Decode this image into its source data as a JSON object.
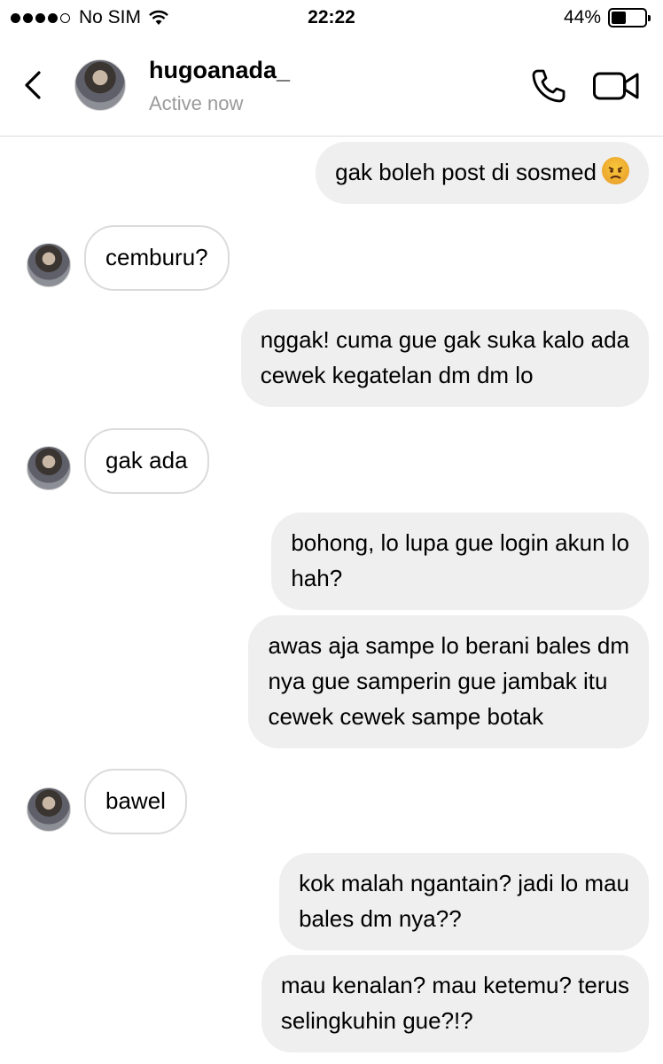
{
  "status_bar": {
    "carrier": "No SIM",
    "time": "22:22",
    "battery_percent": "44%",
    "battery_level": 0.44,
    "signal_bars": 4
  },
  "header": {
    "username": "hugoanada_",
    "status": "Active now",
    "back_icon": "chevron-left-icon",
    "call_icon": "phone-icon",
    "video_icon": "video-camera-icon"
  },
  "messages": [
    {
      "direction": "outgoing",
      "text": "gak boleh post di sosmed",
      "emoji": "angry-face"
    },
    {
      "direction": "incoming",
      "text": "cemburu?"
    },
    {
      "direction": "outgoing",
      "text": "nggak! cuma gue gak suka kalo ada\ncewek kegatelan dm dm lo"
    },
    {
      "direction": "incoming",
      "text": "gak ada"
    },
    {
      "direction": "outgoing",
      "text": "bohong, lo lupa gue login akun lo\nhah?"
    },
    {
      "direction": "outgoing",
      "text": "awas aja sampe lo berani bales dm\nnya gue samperin gue jambak itu\ncewek cewek sampe botak"
    },
    {
      "direction": "incoming",
      "text": "bawel"
    },
    {
      "direction": "outgoing",
      "text": "kok malah ngantain? jadi lo mau\nbales dm nya??"
    },
    {
      "direction": "outgoing",
      "text": "mau kenalan? mau ketemu? terus\nselingkuhin gue?!?"
    }
  ]
}
